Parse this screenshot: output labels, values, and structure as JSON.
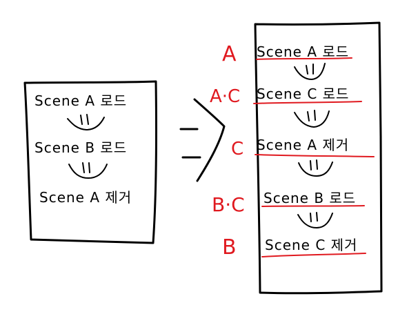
{
  "left_box": {
    "steps": [
      "Scene  A  로드",
      "Scene  B  로드",
      "Scene  A  제거"
    ]
  },
  "right_box": {
    "steps": [
      "Scene  A  로드",
      "Scene  C  로드",
      "Scene  A  제거",
      "Scene  B  로드",
      "Scene  C  제거"
    ],
    "tags": [
      "A",
      "A·C",
      "C",
      "B·C",
      "B"
    ]
  },
  "colors": {
    "ink": "#000000",
    "annotation": "#e0191f"
  }
}
